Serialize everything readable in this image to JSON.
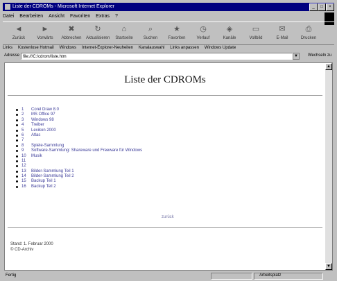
{
  "window": {
    "title": "Liste der CDROMs - Microsoft Internet Explorer",
    "controls": {
      "minimize": "_",
      "maximize": "□",
      "close": "×"
    }
  },
  "menu": [
    "Datei",
    "Bearbeiten",
    "Ansicht",
    "Favoriten",
    "Extras",
    "?"
  ],
  "toolbar": [
    {
      "label": "Zurück",
      "icon": "back-icon",
      "glyph": "◄"
    },
    {
      "label": "Vorwärts",
      "icon": "forward-icon",
      "glyph": "►"
    },
    {
      "label": "Abbrechen",
      "icon": "stop-icon",
      "glyph": "✖"
    },
    {
      "label": "Aktualisieren",
      "icon": "refresh-icon",
      "glyph": "↻"
    },
    {
      "label": "Startseite",
      "icon": "home-icon",
      "glyph": "⌂"
    },
    {
      "label": "Suchen",
      "icon": "search-icon",
      "glyph": "⌕"
    },
    {
      "label": "Favoriten",
      "icon": "favorites-icon",
      "glyph": "★"
    },
    {
      "label": "Verlauf",
      "icon": "history-icon",
      "glyph": "◷"
    },
    {
      "label": "Kanäle",
      "icon": "channels-icon",
      "glyph": "◈"
    },
    {
      "label": "Vollbild",
      "icon": "fullscreen-icon",
      "glyph": "▭"
    },
    {
      "label": "E-Mail",
      "icon": "mail-icon",
      "glyph": "✉"
    },
    {
      "label": "Drucken",
      "icon": "print-icon",
      "glyph": "⎙"
    }
  ],
  "links": [
    "Links",
    "Kostenlose Hotmail",
    "Windows",
    "Internet-Explorer-Neuheiten",
    "Kanalauswahl",
    "Links anpassen",
    "Windows Update"
  ],
  "address": {
    "label": "Adresse",
    "url": "file:///C:/cdrom/liste.htm",
    "go_label": "Wechseln zu"
  },
  "page": {
    "heading": "Liste der CDROMs",
    "items": [
      {
        "num": "1",
        "text": "Corel Draw 8.0"
      },
      {
        "num": "2",
        "text": "MS Office 97"
      },
      {
        "num": "3",
        "text": "Windows 98"
      },
      {
        "num": "4",
        "text": "Treiber"
      },
      {
        "num": "5",
        "text": "Lexikon 2000"
      },
      {
        "num": "6",
        "text": "Atlas"
      },
      {
        "num": "7",
        "text": ""
      },
      {
        "num": "8",
        "text": "Spiele-Sammlung"
      },
      {
        "num": "9",
        "text": "Software-Sammlung: Shareware und Freeware für Windows"
      },
      {
        "num": "10",
        "text": "Musik"
      },
      {
        "num": "11",
        "text": ""
      },
      {
        "num": "12",
        "text": ""
      },
      {
        "num": "13",
        "text": "Bilder-Sammlung Teil 1"
      },
      {
        "num": "14",
        "text": "Bilder-Sammlung Teil 2"
      },
      {
        "num": "15",
        "text": "Backup Teil 1"
      },
      {
        "num": "16",
        "text": "Backup Teil 2"
      }
    ],
    "center_link": "zurück",
    "footer_line1": "Stand: 1. Februar 2000",
    "footer_line2": "© CD-Archiv"
  },
  "status": {
    "text": "Fertig",
    "zone": "Arbeitsplatz"
  }
}
